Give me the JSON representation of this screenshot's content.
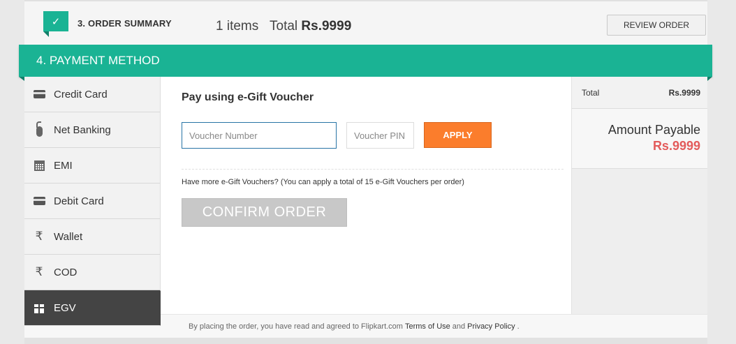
{
  "order_summary": {
    "step_title": "3. ORDER SUMMARY",
    "items": "1 items",
    "total_label": "Total",
    "total_value": "Rs.9999",
    "review_button": "REVIEW ORDER",
    "check_glyph": "✓"
  },
  "payment": {
    "header": "4. PAYMENT METHOD",
    "methods": [
      {
        "label": "Credit Card",
        "icon": "credit-card-icon"
      },
      {
        "label": "Net Banking",
        "icon": "mouse-icon"
      },
      {
        "label": "EMI",
        "icon": "calendar-icon"
      },
      {
        "label": "Debit Card",
        "icon": "debit-card-icon"
      },
      {
        "label": "Wallet",
        "icon": "rupee-icon"
      },
      {
        "label": "COD",
        "icon": "rupee-icon"
      },
      {
        "label": "EGV",
        "icon": "gift-icon",
        "active": true
      }
    ],
    "rupee_glyph": "₹"
  },
  "egv": {
    "title": "Pay using e-Gift Voucher",
    "voucher_number_placeholder": "Voucher Number",
    "voucher_pin_placeholder": "Voucher PIN",
    "apply_button": "APPLY",
    "more_note": "Have more e-Gift Vouchers? (You can apply a total of 15 e-Gift Vouchers per order)",
    "confirm_button": "CONFIRM ORDER"
  },
  "policy": {
    "prefix": "By placing the order, you have read and agreed to Flipkart.com",
    "terms": "Terms of Use",
    "and": "and",
    "privacy": "Privacy Policy",
    "suffix": "."
  },
  "price_summary": {
    "total_label": "Total",
    "total_value": "Rs.9999",
    "payable_label": "Amount Payable",
    "payable_value": "Rs.9999"
  },
  "colors": {
    "accent": "#1ab394",
    "apply": "#fb7d2c",
    "price": "#e35b5b",
    "active_method": "#444444"
  }
}
